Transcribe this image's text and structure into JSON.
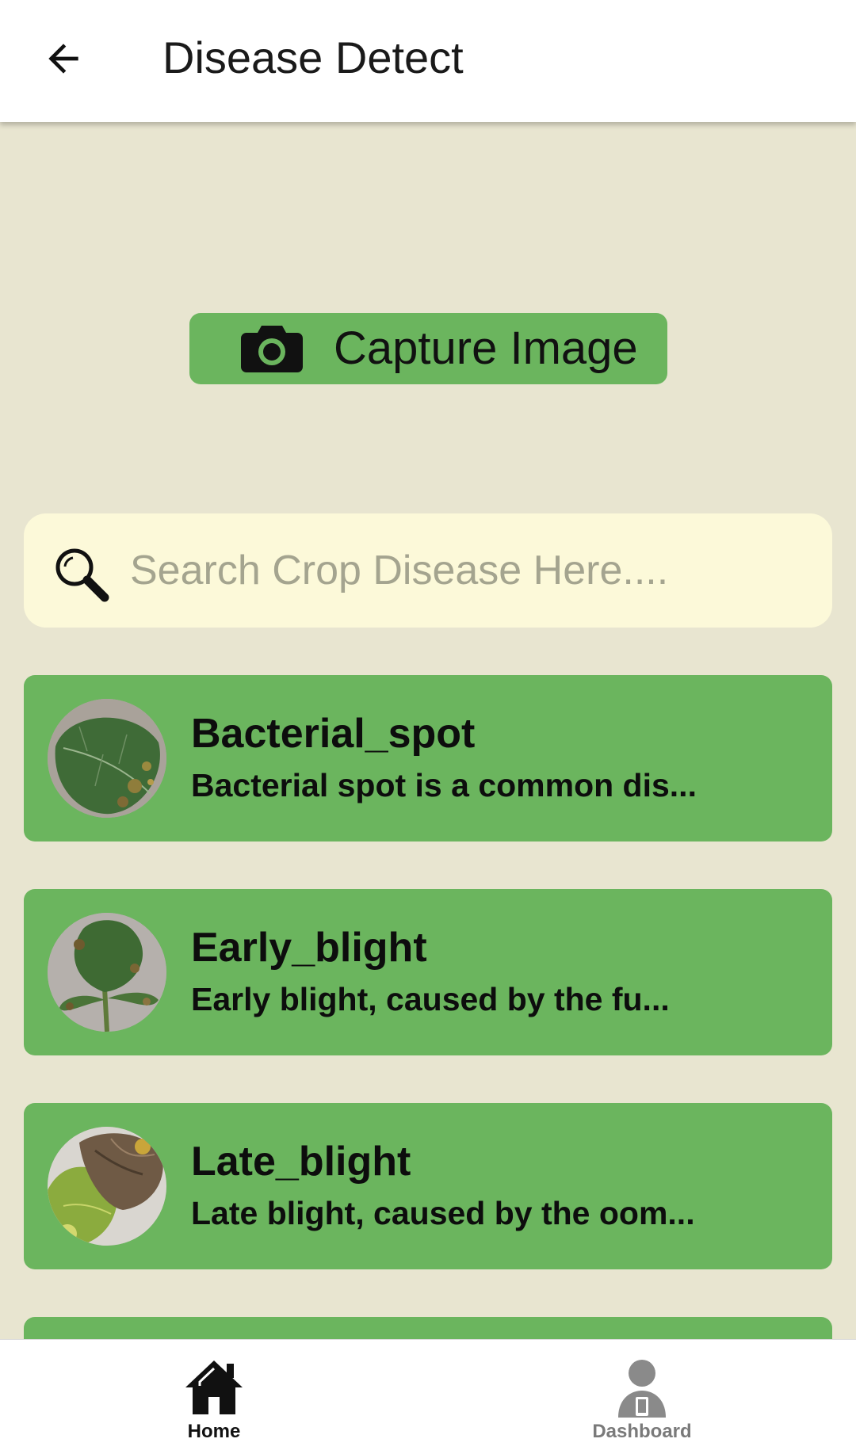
{
  "appbar": {
    "title": "Disease Detect",
    "back_icon": "arrow-back-icon"
  },
  "capture": {
    "label": "Capture Image",
    "icon": "camera-icon"
  },
  "search": {
    "placeholder": "Search Crop Disease Here....",
    "value": "",
    "icon": "search-icon"
  },
  "diseases": [
    {
      "title": "Bacterial_spot",
      "description": "Bacterial spot is a common dis..."
    },
    {
      "title": "Early_blight",
      "description": "Early blight, caused by the fu..."
    },
    {
      "title": "Late_blight",
      "description": "Late blight, caused by the oom..."
    }
  ],
  "bottom_nav": {
    "items": [
      {
        "label": "Home",
        "icon": "home-icon",
        "active": true
      },
      {
        "label": "Dashboard",
        "icon": "dashboard-user-icon",
        "active": false
      }
    ]
  },
  "colors": {
    "background": "#e8e5d0",
    "accent_green": "#6bb55e",
    "search_background": "#fcf9d9",
    "nav_active": "#111111",
    "nav_inactive": "#7a7a7a"
  }
}
